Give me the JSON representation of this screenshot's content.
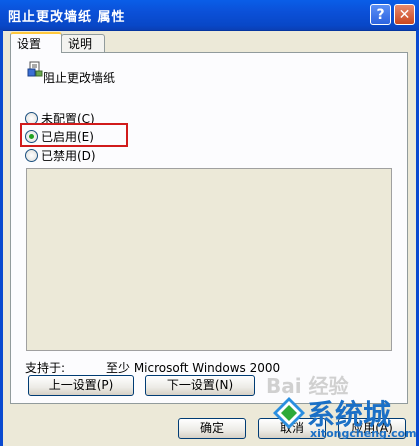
{
  "window": {
    "title": "阻止更改墙纸 属性",
    "help_symbol": "?",
    "close_symbol": "✕"
  },
  "tabs": [
    {
      "label": "设置",
      "active": true
    },
    {
      "label": "说明",
      "active": false
    }
  ],
  "policy": {
    "name": "阻止更改墙纸",
    "icon": "policy-icon"
  },
  "options": [
    {
      "label": "未配置(C)",
      "selected": false
    },
    {
      "label": "已启用(E)",
      "selected": true
    },
    {
      "label": "已禁用(D)",
      "selected": false
    }
  ],
  "supported": {
    "label": "支持于:",
    "value": "至少 Microsoft Windows 2000"
  },
  "buttons": {
    "prev": "上一设置(P)",
    "next": "下一设置(N)",
    "ok": "确定",
    "cancel": "取消",
    "apply": "应用(A)"
  },
  "watermark": {
    "text": "系统城",
    "url": "xitongcheng.com",
    "baidu": "Bai 经验"
  },
  "colors": {
    "titlebar": "#0a5ee8",
    "highlight": "#d11b1b",
    "watermark": "#1b70c6"
  }
}
